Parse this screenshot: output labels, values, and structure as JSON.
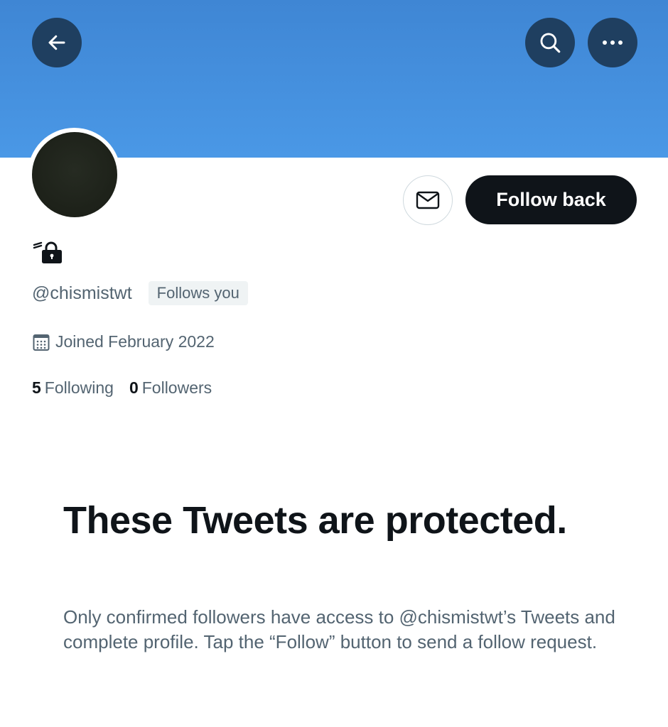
{
  "header": {
    "back_icon": "arrow-left-icon",
    "search_icon": "search-icon",
    "more_icon": "more-horizontal-icon",
    "banner_color": "#4a98e6",
    "button_bg": "#1f3f60"
  },
  "profile": {
    "lock_icon": "lock-icon",
    "handle": "@chismistwt",
    "follows_you_label": "Follows you",
    "joined_text": "Joined February 2022",
    "calendar_icon": "calendar-icon",
    "following_count": "5",
    "following_label": "Following",
    "followers_count": "0",
    "followers_label": "Followers"
  },
  "actions": {
    "message_icon": "envelope-icon",
    "follow_back_label": "Follow back"
  },
  "protected": {
    "title": "These Tweets are protected.",
    "body": "Only confirmed followers have access to @chismistwt’s Tweets and complete profile. Tap the “Follow” button to send a follow request."
  },
  "colors": {
    "text_primary": "#0f1419",
    "text_secondary": "#536471",
    "badge_bg": "#eff3f4"
  }
}
